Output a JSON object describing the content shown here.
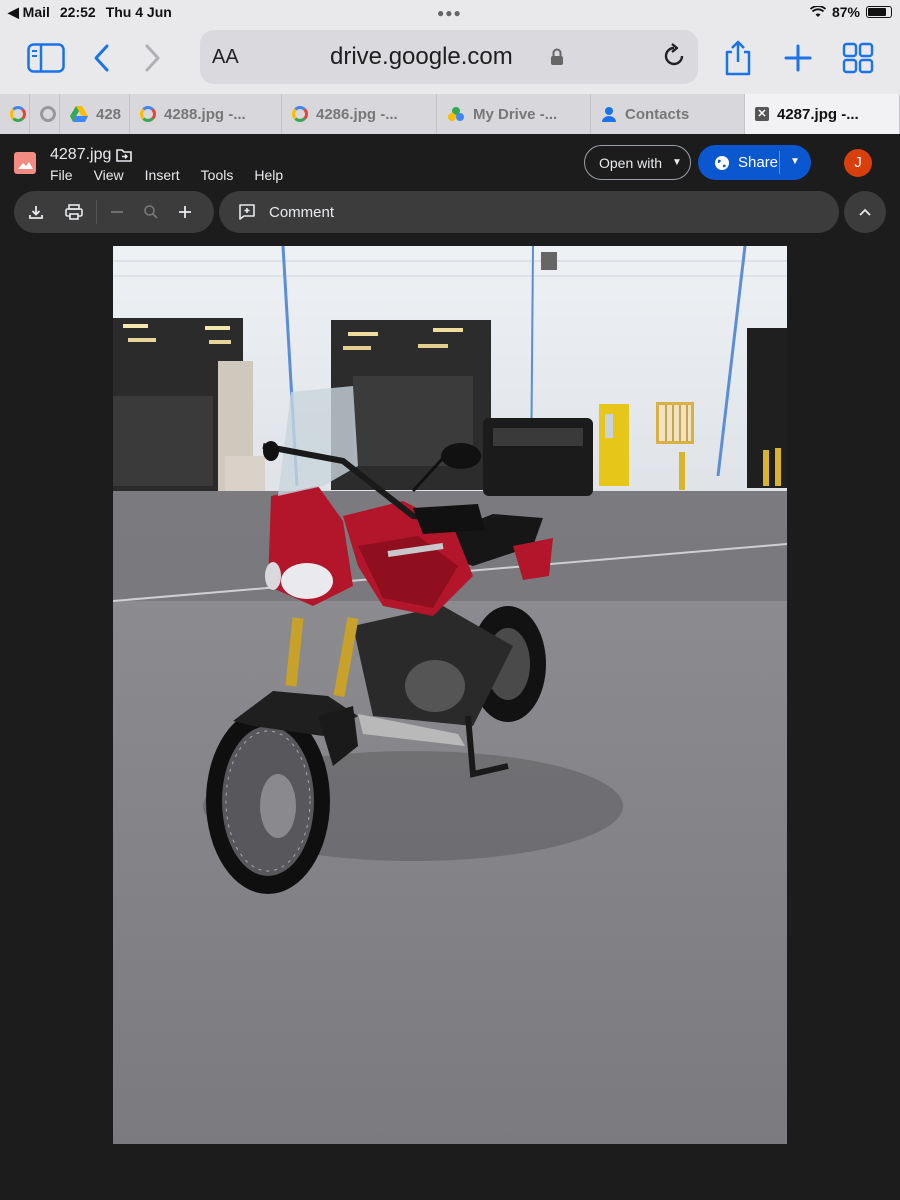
{
  "status_bar": {
    "back_app": "Mail",
    "time": "22:52",
    "date": "Thu 4 Jun",
    "battery": "87%",
    "battery_level": 0.87
  },
  "browser": {
    "text_size": "AA",
    "url": "drive.google.com"
  },
  "tabs": [
    {
      "label": "",
      "icon": "google-g-icon"
    },
    {
      "label": "",
      "icon": "google-g-icon"
    },
    {
      "label": "428",
      "icon": "drive-icon"
    },
    {
      "label": "4288.jpg -...",
      "icon": "google-g-icon"
    },
    {
      "label": "4286.jpg -...",
      "icon": "google-g-icon"
    },
    {
      "label": "My Drive -...",
      "icon": "drive-icon"
    },
    {
      "label": "Contacts",
      "icon": "contacts-icon"
    },
    {
      "label": "4287.jpg -...",
      "icon": "close-icon",
      "active": true
    }
  ],
  "viewer": {
    "file_name": "4287.jpg",
    "menu": [
      "File",
      "View",
      "Insert",
      "Tools",
      "Help"
    ],
    "open_with": "Open with",
    "share": "Share",
    "avatar_initial": "J",
    "comment": "Comment"
  },
  "colors": {
    "share_blue": "#0b57d0",
    "avatar": "#d93f0b",
    "bike_red": "#b3162a",
    "file_icon": "#f28b82"
  }
}
